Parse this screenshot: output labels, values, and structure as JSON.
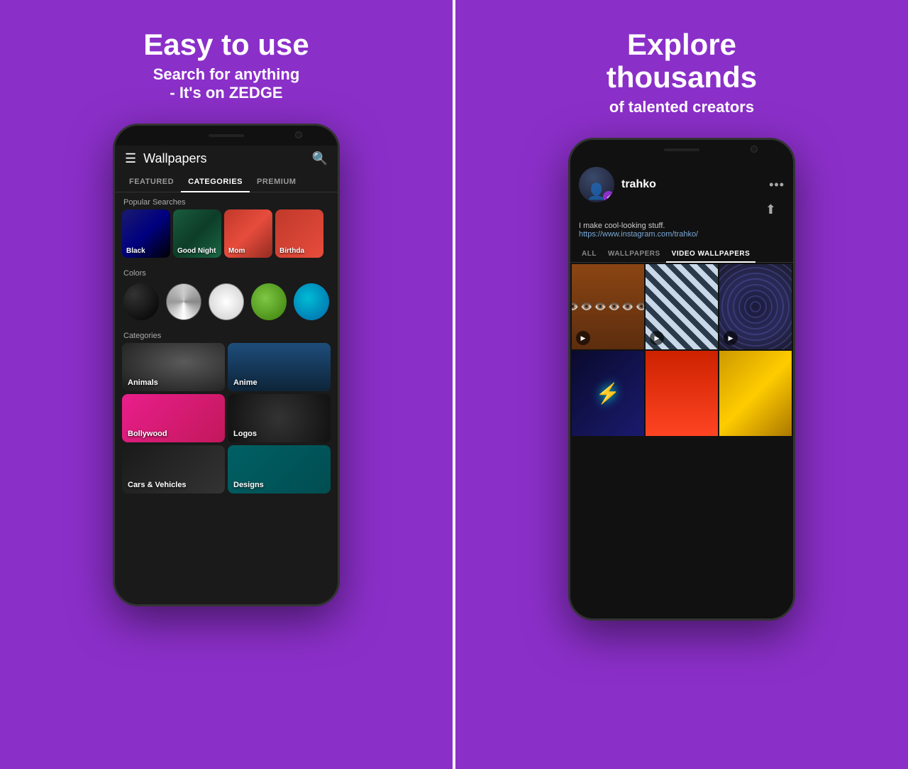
{
  "left_panel": {
    "headline": "Easy to use",
    "subheadline": "Search for anything\n- It's on ZEDGE",
    "phone": {
      "topbar": {
        "title": "Wallpapers"
      },
      "tabs": [
        "FEATURED",
        "CATEGORIES",
        "PREMIUM"
      ],
      "active_tab": "CATEGORIES",
      "popular_searches": {
        "label": "Popular Searches",
        "items": [
          "Black",
          "Good Night",
          "Mom",
          "Birthda"
        ]
      },
      "colors_label": "Colors",
      "categories_label": "Categories",
      "categories": [
        "Animals",
        "Anime",
        "Bollywood",
        "Logos",
        "Cars & Vehicles",
        "Designs"
      ]
    }
  },
  "right_panel": {
    "headline": "Explore\nthousands",
    "subheadline": "of talented creators",
    "phone": {
      "creator": {
        "name": "trahko",
        "verified": true,
        "bio": "I make cool-looking stuff.",
        "link": "https://www.instagram.com/trahko/"
      },
      "content_tabs": [
        "ALL",
        "WALLPAPERS",
        "VIDEO WALLPAPERS"
      ],
      "active_content_tab": "VIDEO WALLPAPERS"
    }
  },
  "icons": {
    "hamburger": "☰",
    "search": "🔍",
    "more": "•••",
    "share": "⬆",
    "video_play": "▶",
    "verified": "✓"
  }
}
